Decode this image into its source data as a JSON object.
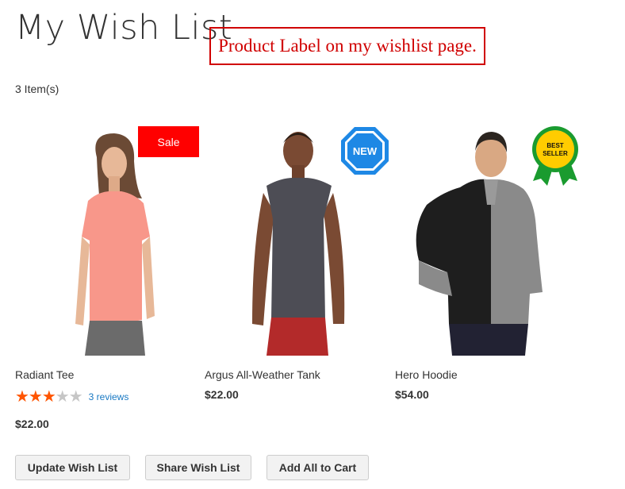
{
  "page": {
    "title": "My Wish List",
    "annotation": "Product Label on my wishlist page.",
    "item_count": "3 Item(s)"
  },
  "products": [
    {
      "name": "Radiant Tee",
      "price": "$22.00",
      "label": "Sale",
      "rating": 3,
      "rating_max": 5,
      "reviews": "3 reviews"
    },
    {
      "name": "Argus All-Weather Tank",
      "price": "$22.00",
      "label": "NEW"
    },
    {
      "name": "Hero Hoodie",
      "price": "$54.00",
      "label_line1": "BEST",
      "label_line2": "SELLER"
    }
  ],
  "actions": {
    "update": "Update Wish List",
    "share": "Share Wish List",
    "add_all": "Add All to Cart"
  },
  "colors": {
    "sale_label": "#ff0000",
    "new_label": "#1e88e5",
    "bestseller_badge": "#ffcc00",
    "bestseller_ribbon": "#1a9b2f",
    "star_on": "#ff5501",
    "annotation": "#d00000"
  }
}
